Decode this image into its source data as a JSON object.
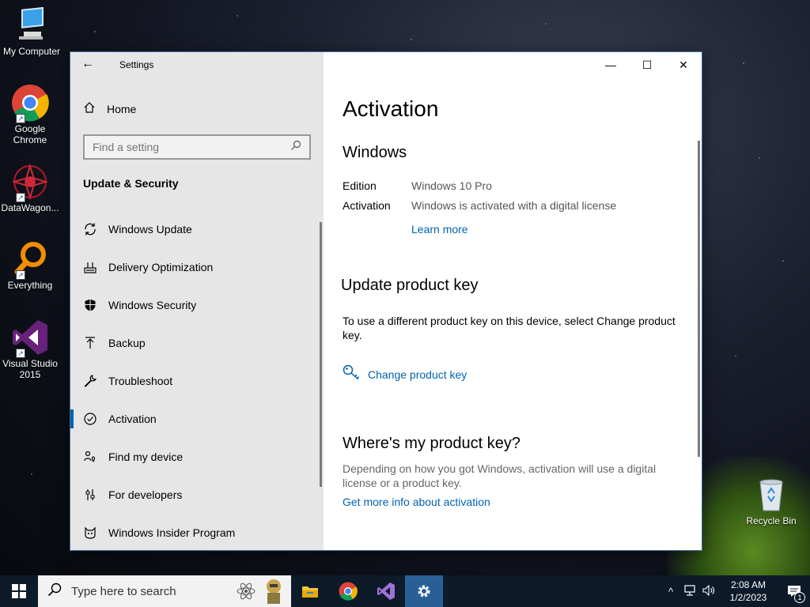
{
  "desktop": {
    "icons": [
      {
        "label": "My Computer",
        "icon": "computer-icon"
      },
      {
        "label": "Google Chrome",
        "icon": "chrome-icon"
      },
      {
        "label": "DataWagon...",
        "icon": "datawagon-icon"
      },
      {
        "label": "Everything",
        "icon": "everything-search-icon"
      },
      {
        "label": "Visual Studio 2015",
        "icon": "visual-studio-icon"
      },
      {
        "label": "Recycle Bin",
        "icon": "recycle-bin-icon"
      }
    ]
  },
  "window": {
    "title": "Settings",
    "back": "←",
    "minimize": "—",
    "maximize": "☐",
    "close": "✕"
  },
  "sidebar": {
    "home_label": "Home",
    "search_placeholder": "Find a setting",
    "section_title": "Update & Security",
    "items": [
      {
        "label": "Windows Update",
        "icon": "sync-icon"
      },
      {
        "label": "Delivery Optimization",
        "icon": "delivery-optimization-icon"
      },
      {
        "label": "Windows Security",
        "icon": "shield-icon"
      },
      {
        "label": "Backup",
        "icon": "backup-arrow-icon"
      },
      {
        "label": "Troubleshoot",
        "icon": "wrench-icon"
      },
      {
        "label": "Activation",
        "icon": "check-circle-icon",
        "active": true
      },
      {
        "label": "Find my device",
        "icon": "person-pin-icon"
      },
      {
        "label": "For developers",
        "icon": "developer-sliders-icon"
      },
      {
        "label": "Windows Insider Program",
        "icon": "insider-cat-icon"
      }
    ]
  },
  "main": {
    "page_title": "Activation",
    "windows_section": {
      "heading": "Windows",
      "edition_key": "Edition",
      "edition_value": "Windows 10 Pro",
      "activation_key": "Activation",
      "activation_value": "Windows is activated with a digital license",
      "learn_more": "Learn more"
    },
    "product_key_section": {
      "heading": "Update product key",
      "description": "To use a different product key on this device, select Change product key.",
      "change_link": "Change product key"
    },
    "where_section": {
      "heading": "Where's my product key?",
      "description": "Depending on how you got Windows, activation will use a digital license or a product key.",
      "info_link": "Get more info about activation"
    }
  },
  "taskbar": {
    "search_placeholder": "Type here to search",
    "time": "2:08 AM",
    "date": "1/2/2023",
    "notification_count": "1",
    "accent": "#0c1a2a"
  }
}
